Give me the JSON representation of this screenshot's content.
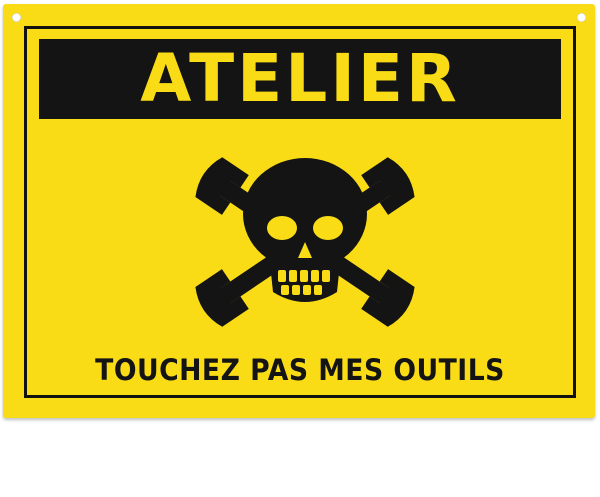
{
  "sign": {
    "title": "ATELIER",
    "caption": "TOUCHEZ PAS MES OUTILS",
    "colors": {
      "background": "#f9dc16",
      "ink": "#141414"
    },
    "emblem": "skull-and-crossed-wrenches-icon"
  }
}
